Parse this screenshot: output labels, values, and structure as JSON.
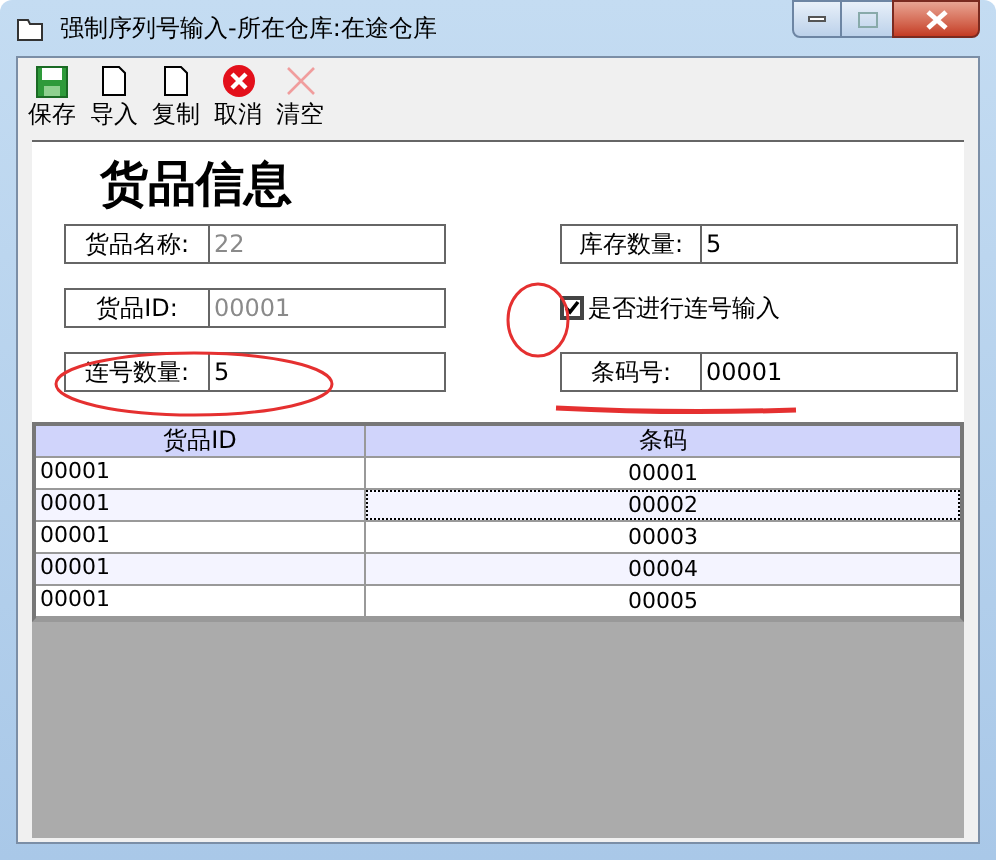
{
  "window": {
    "title": "强制序列号输入-所在仓库:在途仓库"
  },
  "toolbar": [
    {
      "kind": "save",
      "label": "保存",
      "disabled": false
    },
    {
      "kind": "page",
      "label": "导入",
      "disabled": false
    },
    {
      "kind": "page",
      "label": "复制",
      "disabled": false
    },
    {
      "kind": "cancel",
      "label": "取消",
      "disabled": false
    },
    {
      "kind": "clear",
      "label": "清空",
      "disabled": true
    }
  ],
  "form": {
    "title": "货品信息",
    "fields": [
      {
        "label": "货品名称:",
        "value": "22",
        "disabled": true
      },
      {
        "label": "库存数量:",
        "value": "5",
        "disabled": false
      },
      {
        "label": "货品ID:",
        "value": "00001",
        "disabled": true
      },
      {
        "kind": "checkbox",
        "label": "是否进行连号输入",
        "checked": true
      },
      {
        "label": "连号数量:",
        "value": "5",
        "disabled": false
      },
      {
        "label": "条码号:",
        "value": "00001",
        "disabled": false
      }
    ]
  },
  "table": {
    "columns": [
      "货品ID",
      "条码"
    ],
    "rows": [
      {
        "cells": [
          "00001",
          "00001"
        ],
        "focused": false
      },
      {
        "cells": [
          "00001",
          "00002"
        ],
        "focused": true
      },
      {
        "cells": [
          "00001",
          "00003"
        ],
        "focused": false
      },
      {
        "cells": [
          "00001",
          "00004"
        ],
        "focused": false
      },
      {
        "cells": [
          "00001",
          "00005"
        ],
        "focused": false
      }
    ]
  }
}
